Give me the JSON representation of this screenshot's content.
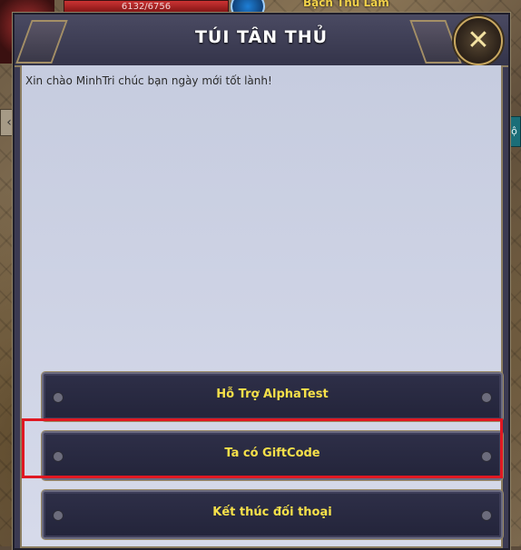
{
  "hud": {
    "hp_text": "6132/6756",
    "player_name": "Bạch Thủ Lâm",
    "right_tab_label": "hộ"
  },
  "dialog": {
    "title": "TÚI TÂN THỦ",
    "close_icon": "close-x-icon",
    "greeting": "Xin chào MinhTri chúc bạn ngày mới tốt lành!",
    "options": [
      {
        "label": "Hỗ Trợ AlphaTest"
      },
      {
        "label": "Ta có GiftCode",
        "highlighted": true
      },
      {
        "label": "Kết thúc đối thoại"
      }
    ]
  },
  "colors": {
    "option_text": "#f5e04a",
    "highlight_border": "#e01822",
    "content_bg": "#cdd2e4"
  }
}
